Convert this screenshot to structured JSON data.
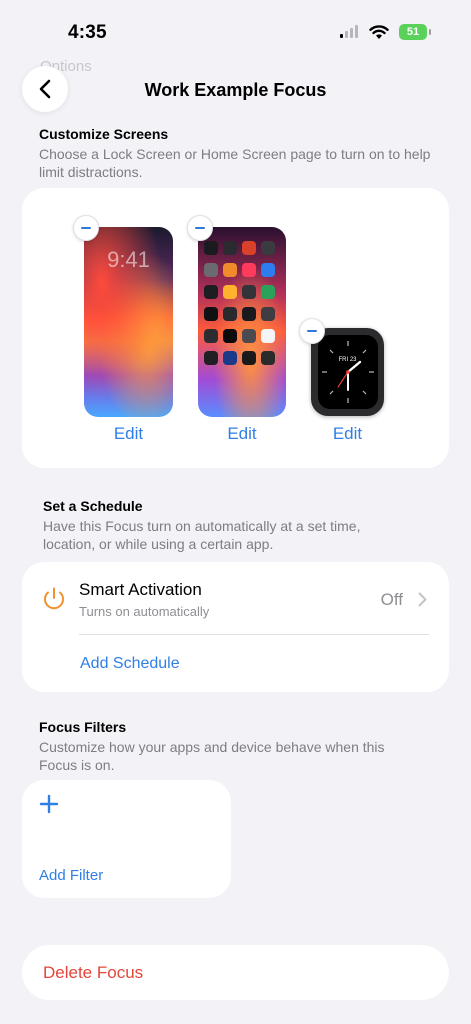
{
  "status_bar": {
    "time": "4:35",
    "battery": "51"
  },
  "background_ghost": {
    "text": "Options"
  },
  "nav": {
    "title": "Work Example Focus"
  },
  "customize": {
    "title": "Customize Screens",
    "description": "Choose a Lock Screen or Home Screen page to turn on to help limit distractions.",
    "lock_screen_time": "9:41",
    "watch_date": "FRI 23",
    "edit_labels": [
      "Edit",
      "Edit",
      "Edit"
    ]
  },
  "schedule": {
    "title": "Set a Schedule",
    "description": "Have this Focus turn on automatically at a set time, location, or while using a certain app.",
    "smart_activation_label": "Smart Activation",
    "smart_activation_sub": "Turns on automatically",
    "smart_activation_value": "Off",
    "add_schedule_label": "Add Schedule"
  },
  "filters": {
    "title": "Focus Filters",
    "description": "Customize how your apps and device behave when this Focus is on.",
    "add_filter_label": "Add Filter"
  },
  "delete": {
    "label": "Delete Focus"
  },
  "colors": {
    "accent": "#2f7fe6",
    "destructive": "#e5453a",
    "power_icon": "#f0922e",
    "background": "#f2f2f7"
  }
}
